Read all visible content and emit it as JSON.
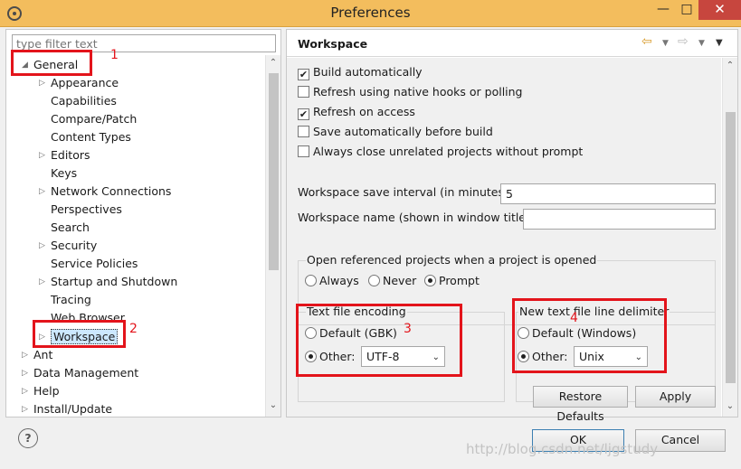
{
  "window": {
    "title": "Preferences",
    "minimize": "—",
    "maximize": "□",
    "close": "✕"
  },
  "filter": {
    "placeholder": "type filter text"
  },
  "tree": {
    "general": "General",
    "children": [
      "Appearance",
      "Capabilities",
      "Compare/Patch",
      "Content Types",
      "Editors",
      "Keys",
      "Network Connections",
      "Perspectives",
      "Search",
      "Security",
      "Service Policies",
      "Startup and Shutdown",
      "Tracing",
      "Web Browser",
      "Workspace"
    ],
    "top": [
      "Ant",
      "Data Management",
      "Help",
      "Install/Update"
    ]
  },
  "page": {
    "title": "Workspace",
    "checks": [
      {
        "label": "Build automatically",
        "checked": true
      },
      {
        "label": "Refresh using native hooks or polling",
        "checked": false
      },
      {
        "label": "Refresh on access",
        "checked": true
      },
      {
        "label": "Save automatically before build",
        "checked": false
      },
      {
        "label": "Always close unrelated projects without prompt",
        "checked": false
      }
    ],
    "save_interval_label": "Workspace save interval (in minutes):",
    "save_interval_value": "5",
    "ws_name_label": "Workspace name (shown in window title):",
    "ws_name_value": "",
    "open_ref": {
      "label": "Open referenced projects when a project is opened",
      "always": "Always",
      "never": "Never",
      "prompt": "Prompt",
      "selected": "Prompt"
    },
    "encoding": {
      "label": "Text file encoding",
      "default": "Default (GBK)",
      "other": "Other:",
      "value": "UTF-8",
      "selected": "Other"
    },
    "delimiter": {
      "label": "New text file line delimiter",
      "default": "Default (Windows)",
      "other": "Other:",
      "value": "Unix",
      "selected": "Other"
    },
    "restore_defaults": "Restore Defaults",
    "apply": "Apply"
  },
  "footer": {
    "ok": "OK",
    "cancel": "Cancel",
    "help": "?"
  },
  "annotations": [
    "1",
    "2",
    "3",
    "4"
  ],
  "watermark": "http://blog.csdn.net/ljgstudy",
  "colors": {
    "titlebar": "#f3bd5d",
    "annotation": "#e3141b",
    "selection": "#cce8ff"
  }
}
